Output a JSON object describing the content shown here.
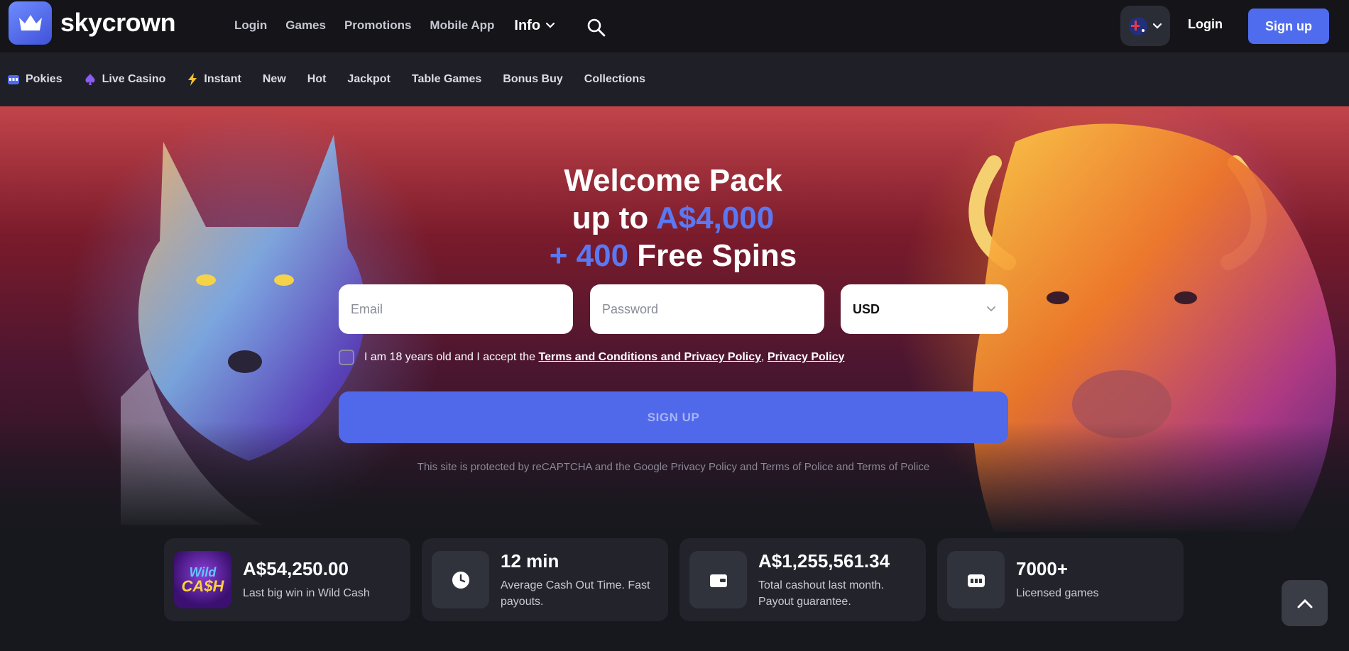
{
  "header": {
    "brand": "skycrown",
    "nav": [
      "Login",
      "Games",
      "Promotions",
      "Mobile App"
    ],
    "info_label": "Info",
    "login_label": "Login",
    "signup_label": "Sign up",
    "icons": {
      "logo": "crown-icon",
      "search": "search-icon",
      "language": "australia-flag-icon",
      "dropdown": "chevron-down-icon"
    }
  },
  "categories": [
    {
      "label": "Pokies",
      "icon": "slot-machine-icon"
    },
    {
      "label": "Live Casino",
      "icon": "spade-icon"
    },
    {
      "label": "Instant",
      "icon": "lightning-icon"
    },
    {
      "label": "New"
    },
    {
      "label": "Hot"
    },
    {
      "label": "Jackpot"
    },
    {
      "label": "Table Games"
    },
    {
      "label": "Bonus Buy"
    },
    {
      "label": "Collections"
    }
  ],
  "hero": {
    "line1": "Welcome Pack",
    "line2_prefix": "up to ",
    "line2_amount": "A$4,000",
    "line3_amount": "+ 400",
    "line3_suffix": " Free Spins",
    "email_placeholder": "Email",
    "password_placeholder": "Password",
    "currency": "USD",
    "terms_prefix": "I am 18 years old and I accept the ",
    "terms_link": "Terms and Conditions and Privacy Policy",
    "terms_separator": ", ",
    "privacy_link": "Privacy Policy",
    "cta": "SIGN UP",
    "recaptcha": "This site is protected by reCAPTCHA and the Google Privacy Policy and Terms of Police and Terms of Police"
  },
  "stats": [
    {
      "value": "A$54,250.00",
      "label": "Last big win in Wild Cash",
      "icon": "wild-cash-game-icon",
      "icon_text_1": "Wild",
      "icon_text_2": "CA$H"
    },
    {
      "value": "12 min",
      "label": "Average Cash Out Time. Fast payouts.",
      "icon": "clock-icon"
    },
    {
      "value": "A$1,255,561.34",
      "label": "Total cashout last month. Payout guarantee.",
      "icon": "wallet-icon"
    },
    {
      "value": "7000+",
      "label": "Licensed games",
      "icon": "slot-machine-icon"
    }
  ],
  "colors": {
    "accent": "#4f6cef",
    "background": "#17181d",
    "header": "#141419",
    "category_bar": "#1f2027",
    "card": "#22232b"
  }
}
